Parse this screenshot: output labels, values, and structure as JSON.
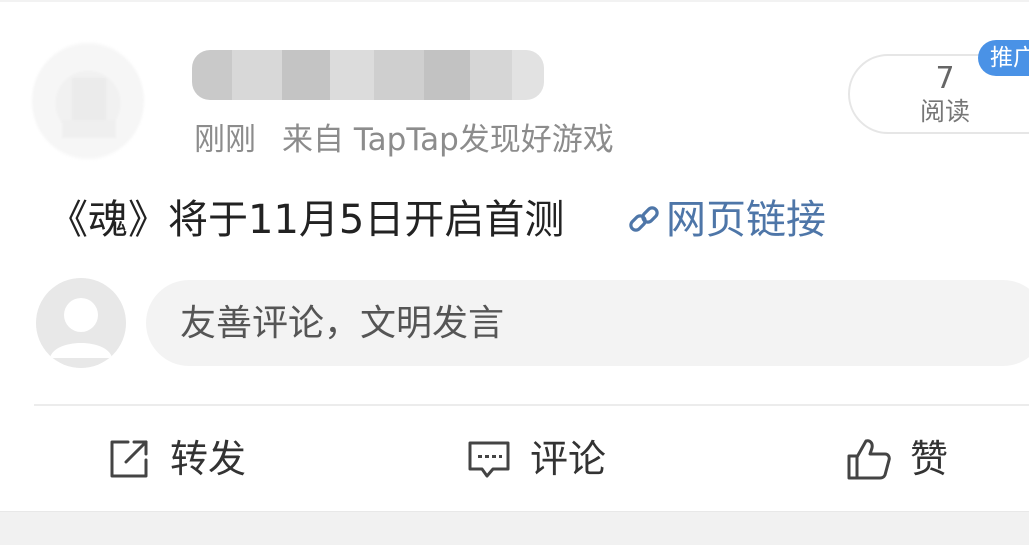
{
  "header": {
    "time": "刚刚",
    "source": "来自 TapTap发现好游戏",
    "read_count": "7",
    "read_label": "阅读",
    "promo_badge": "推广"
  },
  "post": {
    "text": "《魂》将于11月5日开启首测",
    "link_label": "网页链接",
    "link_icon": "link-icon"
  },
  "comment": {
    "placeholder": "友善评论，文明发言"
  },
  "actions": [
    {
      "label": "转发",
      "icon": "share-icon"
    },
    {
      "label": "评论",
      "icon": "comment-icon"
    },
    {
      "label": "赞",
      "icon": "thumbs-up-icon"
    }
  ],
  "colors": {
    "link": "#4e76a8",
    "badge": "#4a92e6",
    "meta_text": "#8c8c8c",
    "body_text": "#222222"
  }
}
